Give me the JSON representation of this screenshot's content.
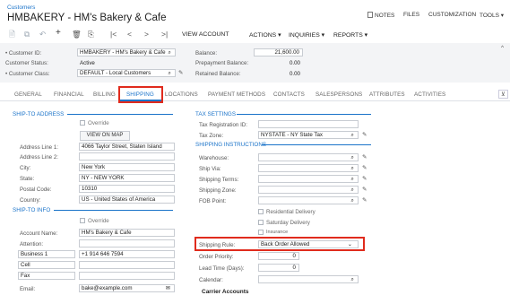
{
  "breadcrumb": "Customers",
  "page_title": "HMBAKERY - HM's Bakery & Cafe",
  "topnav": [
    "NOTES",
    "FILES",
    "CUSTOMIZATION",
    "TOOLS ▾"
  ],
  "toolbar": {
    "view_account": "VIEW ACCOUNT",
    "actions": "ACTIONS ▾",
    "inquiries": "INQUIRIES ▾",
    "reports": "REPORTS ▾"
  },
  "header": {
    "customer_id_label": "• Customer ID:",
    "customer_id": "HMBAKERY - HM's Bakery & Cafe",
    "status_label": "Customer Status:",
    "status": "Active",
    "class_label": "• Customer Class:",
    "class": "DEFAULT - Local Customers",
    "balance_label": "Balance:",
    "balance": "21,600.00",
    "prepayment_label": "Prepayment Balance:",
    "prepayment": "0.00",
    "retained_label": "Retained Balance:",
    "retained": "0.00"
  },
  "tabs": [
    "GENERAL",
    "FINANCIAL",
    "BILLING",
    "SHIPPING",
    "LOCATIONS",
    "PAYMENT METHODS",
    "CONTACTS",
    "SALESPERSONS",
    "ATTRIBUTES",
    "ACTIVITIES"
  ],
  "ship_to": {
    "section": "SHIP-TO ADDRESS",
    "override": "Override",
    "view_on_map": "VIEW ON MAP",
    "addr1_label": "Address Line 1:",
    "addr1": "4066 Taylor Street, Staten Island",
    "addr2_label": "Address Line 2:",
    "addr2": "",
    "city_label": "City:",
    "city": "New York",
    "state_label": "State:",
    "state": "NY - NEW YORK",
    "postal_label": "Postal Code:",
    "postal": "10310",
    "country_label": "Country:",
    "country": "US - United States of America"
  },
  "ship_info": {
    "section": "SHIP-TO INFO",
    "override": "Override",
    "account_name_label": "Account Name:",
    "account_name": "HM's Bakery & Cafe",
    "attention_label": "Attention:",
    "attention": "",
    "business1_label": "Business 1",
    "business1": "+1 914 646 7594",
    "cell_label": "Cell",
    "cell": "",
    "fax_label": "Fax",
    "fax": "",
    "email_label": "Email:",
    "email": "bake@example.com"
  },
  "tax": {
    "section": "TAX SETTINGS",
    "reg_label": "Tax Registration ID:",
    "reg": "",
    "zone_label": "Tax Zone:",
    "zone": "NYSTATE - NY State Tax"
  },
  "shipping_instr": {
    "section": "SHIPPING INSTRUCTIONS",
    "warehouse_label": "Warehouse:",
    "shipvia_label": "Ship Via:",
    "terms_label": "Shipping Terms:",
    "zone_label": "Shipping Zone:",
    "fob_label": "FOB Point:",
    "residential": "Residential Delivery",
    "saturday": "Saturday Delivery",
    "insurance": "Insurance",
    "rule_label": "Shipping Rule:",
    "rule": "Back Order Allowed",
    "priority_label": "Order Priority:",
    "priority": "0",
    "lead_label": "Lead Time (Days):",
    "lead": "0",
    "calendar_label": "Calendar:",
    "carrier": "Carrier Accounts"
  },
  "colors": {
    "accent": "#1a73c9",
    "highlight": "#e02b1d"
  }
}
